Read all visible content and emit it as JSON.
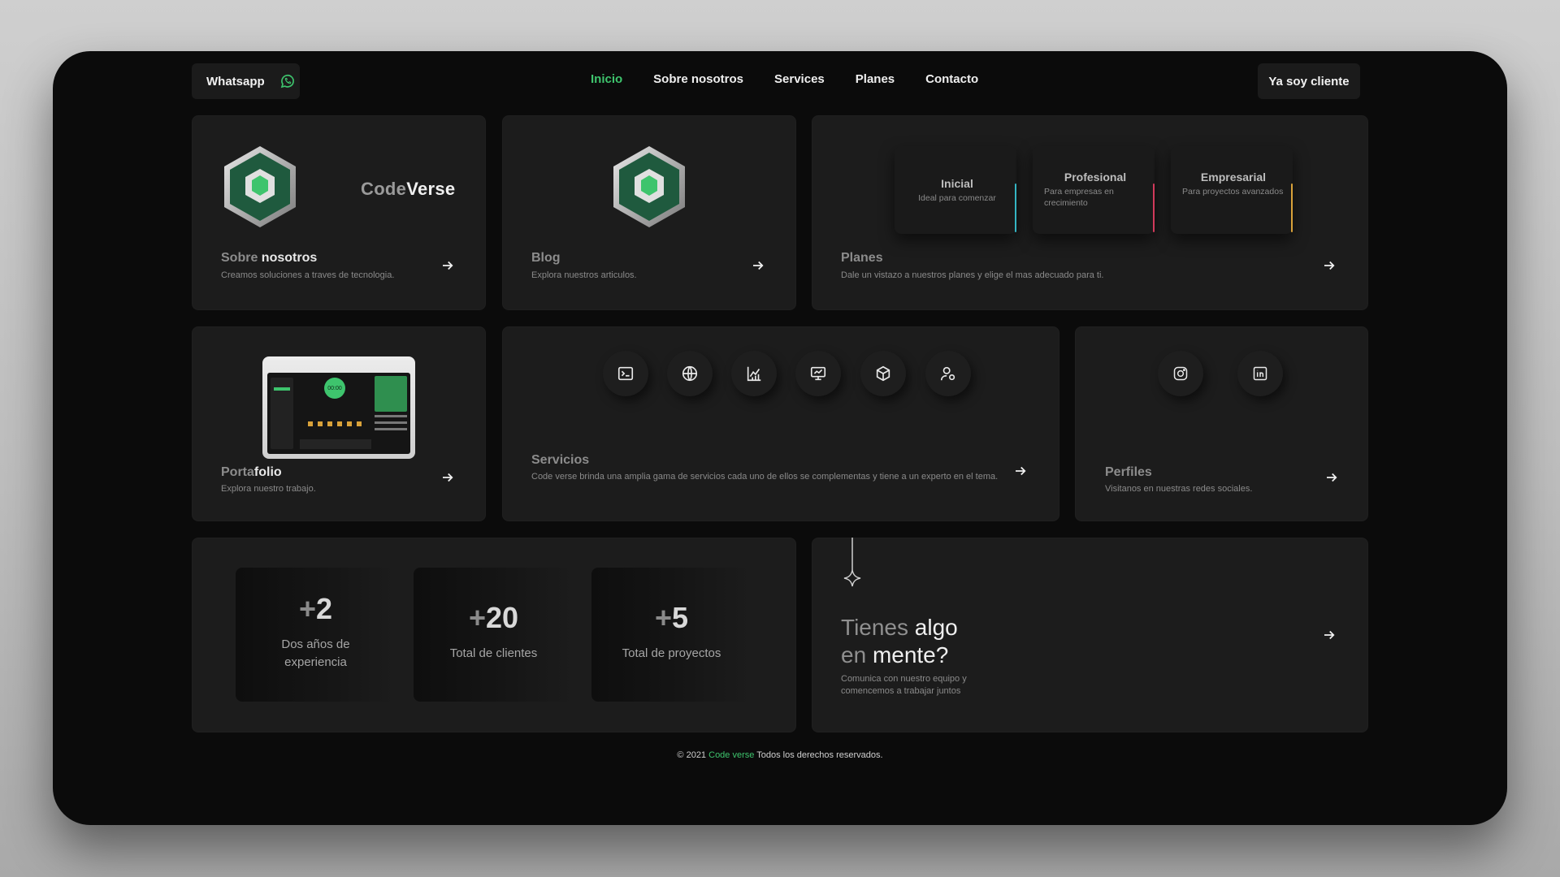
{
  "header": {
    "whatsapp_label": "Whatsapp",
    "nav": [
      "Inicio",
      "Sobre nosotros",
      "Services",
      "Planes",
      "Contacto"
    ],
    "active_nav": "Inicio",
    "client_button": "Ya soy cliente"
  },
  "cards": {
    "about": {
      "brand_light": "Code",
      "brand_bold": "Verse",
      "title_light": "Sobre",
      "title_bold": "nosotros",
      "desc": "Creamos soluciones a traves de tecnologia."
    },
    "blog": {
      "title": "Blog",
      "desc": "Explora nuestros articulos."
    },
    "plans": {
      "title": "Planes",
      "desc": "Dale un vistazo a nuestros planes y elige el mas adecuado para ti.",
      "tiles": [
        {
          "name": "Inicial",
          "desc": "Ideal para comenzar",
          "accent": "#35b6c4"
        },
        {
          "name": "Profesional",
          "desc": "Para empresas en crecimiento",
          "accent": "#d23b5c"
        },
        {
          "name": "Empresarial",
          "desc": "Para proyectos avanzados",
          "accent": "#d9a23a"
        }
      ]
    },
    "portfolio": {
      "title_light": "Porta",
      "title_bold": "folio",
      "desc": "Explora nuestro trabajo.",
      "preview_timer": "00:00"
    },
    "services": {
      "title": "Servicios",
      "desc": "Code verse brinda una amplia gama de servicios cada uno de ellos se complementas y tiene a un experto en el tema.",
      "icons": [
        "terminal-icon",
        "globe-icon",
        "chart-icon",
        "monitor-icon",
        "cube-icon",
        "user-settings-icon"
      ]
    },
    "profiles": {
      "title": "Perfiles",
      "desc": "Visitanos en nuestras redes sociales.",
      "icons": [
        "instagram-icon",
        "linkedin-icon"
      ]
    },
    "stats": [
      {
        "plus": "+",
        "value": "2",
        "label_1": "Dos años de",
        "label_2": "experiencia"
      },
      {
        "plus": "+",
        "value": "20",
        "label_1": "Total de clientes",
        "label_2": ""
      },
      {
        "plus": "+",
        "value": "5",
        "label_1": "Total de proyectos",
        "label_2": ""
      }
    ],
    "cta": {
      "line1_light": "Tienes",
      "line1_bold": "algo",
      "line2_light": "en",
      "line2_bold": "mente?",
      "desc_1": "Comunica con nuestro equipo y",
      "desc_2": "comencemos a trabajar juntos"
    }
  },
  "footer": {
    "prefix": "© 2021",
    "brand": "Code verse",
    "suffix": "Todos los derechos reservados."
  },
  "colors": {
    "accent": "#3ec46d",
    "background": "#0b0b0b",
    "card": "#1c1c1c"
  }
}
